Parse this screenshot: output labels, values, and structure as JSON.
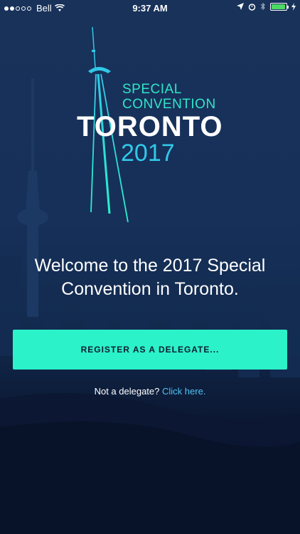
{
  "status_bar": {
    "carrier": "Bell",
    "time": "9:37 AM",
    "signal_bars_filled": 2,
    "signal_bars_total": 5,
    "battery_level_fraction": 0.85,
    "icons": [
      "wifi-icon",
      "location-icon",
      "alarm-icon",
      "bluetooth-icon",
      "battery-icon",
      "charging-icon"
    ]
  },
  "logo": {
    "line1": "SPECIAL",
    "line2": "CONVENTION",
    "city": "TORONTO",
    "year": "2017",
    "colors": {
      "accent": "#32e4c8",
      "year": "#32c8e8"
    }
  },
  "welcome": {
    "line1": "Welcome to the 2017 Special",
    "line2": "Convention in Toronto."
  },
  "register_button": {
    "label": "REGISTER AS A DELEGATE...",
    "color": "#2bf2c9"
  },
  "not_delegate": {
    "prefix": "Not a delegate?",
    "link": "Click here.",
    "link_color": "#4fc3f7"
  }
}
